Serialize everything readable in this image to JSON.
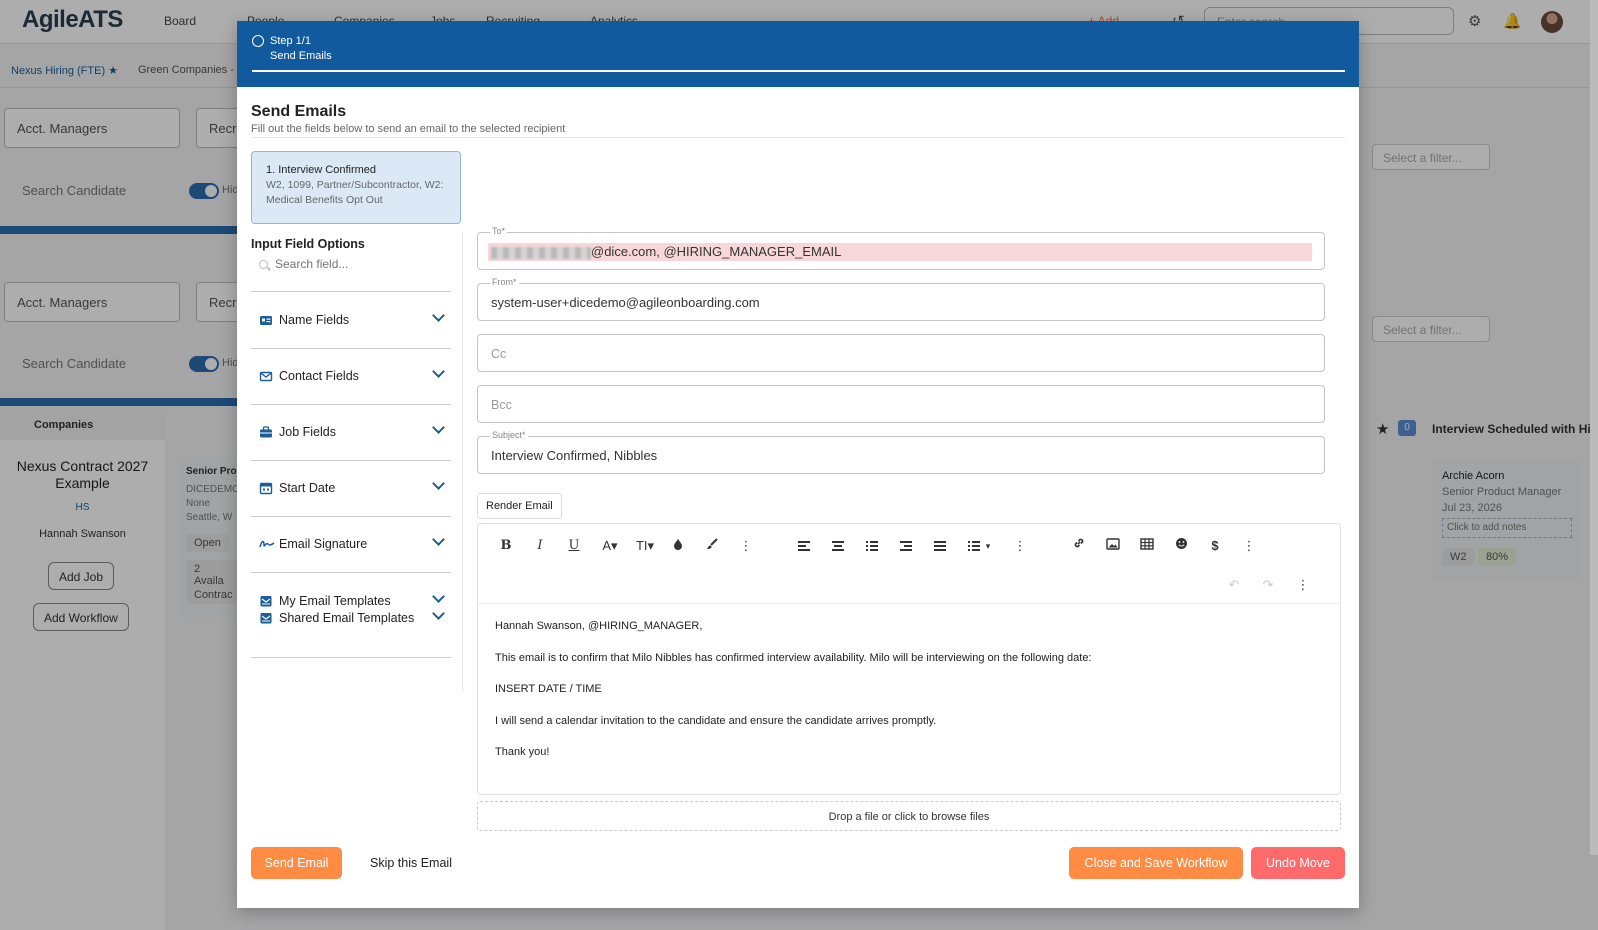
{
  "background": {
    "logo": "AgileATS",
    "nav": [
      "Board",
      "People",
      "Companies",
      "Jobs",
      "Recruiting",
      "Analytics"
    ],
    "add_label": "+ Add",
    "search_placeholder": "Enter search",
    "tabs": [
      "Nexus Hiring (FTE) ★",
      "Green Companies -"
    ],
    "filters": {
      "acct_managers": "Acct. Managers",
      "recruiter": "Recru",
      "search_candidate": "Search Candidate",
      "hide": "Hid",
      "select_filter": "Select a filter..."
    },
    "companies_header": "Companies",
    "company": {
      "name": "Nexus Contract 2027 Example",
      "initials": "HS",
      "person": "Hannah Swanson",
      "add_job": "Add Job",
      "add_workflow": "Add Workflow"
    },
    "middle_card": {
      "title": "Senior Pro",
      "lines": [
        "DICEDEMO",
        "None",
        "Seattle, W"
      ],
      "tags": [
        "Open",
        "2 Availa",
        "Contrac"
      ]
    },
    "right_column": {
      "header": "Interview Scheduled with Hi..",
      "count": "0",
      "candidate_name": "Archie Acorn",
      "candidate_title": "Senior Product Manager",
      "candidate_date": "Jul 23, 2026",
      "notes_placeholder": "Click to add notes",
      "tag1": "W2",
      "tag2": "80%"
    }
  },
  "modal": {
    "step_number": "Step 1/1",
    "step_label": "Send Emails",
    "title": "Send Emails",
    "subtitle": "Fill out the fields below to send an email to the selected recipient",
    "workflow_card": {
      "title": "1. Interview Confirmed",
      "subtitle": "W2, 1099, Partner/Subcontractor, W2: Medical Benefits Opt Out"
    },
    "input_options_title": "Input Field Options",
    "search_placeholder": "Search field...",
    "accordion": [
      {
        "label": "Name Fields"
      },
      {
        "label": "Contact Fields"
      },
      {
        "label": "Job Fields"
      },
      {
        "label": "Start Date"
      },
      {
        "label": "Email Signature"
      },
      {
        "label": "My Email Templates"
      },
      {
        "label": "Shared Email Templates"
      }
    ],
    "form": {
      "to_label": "To*",
      "to_value": "@dice.com, @HIRING_MANAGER_EMAIL",
      "from_label": "From*",
      "from_value": "system-user+dicedemo@agileonboarding.com",
      "cc_placeholder": "Cc",
      "bcc_placeholder": "Bcc",
      "subject_label": "Subject*",
      "subject_value": "Interview Confirmed,  Nibbles"
    },
    "render_button": "Render Email",
    "email_body": [
      "Hannah Swanson, @HIRING_MANAGER,",
      "This email is to confirm that Milo Nibbles has confirmed interview availability.  Milo will be interviewing on the following date:",
      "INSERT DATE / TIME",
      "I will send a calendar invitation to the candidate and ensure the candidate arrives promptly.",
      "Thank you!"
    ],
    "dropzone": "Drop a file or click to browse files",
    "buttons": {
      "send": "Send Email",
      "skip": "Skip this Email",
      "close_save": "Close and Save Workflow",
      "undo": "Undo Move"
    }
  },
  "colors": {
    "header_blue": "#115a9e",
    "accent_orange": "#ff8c42",
    "accent_red": "#ff6b6b",
    "to_highlight": "#f8d7da"
  }
}
